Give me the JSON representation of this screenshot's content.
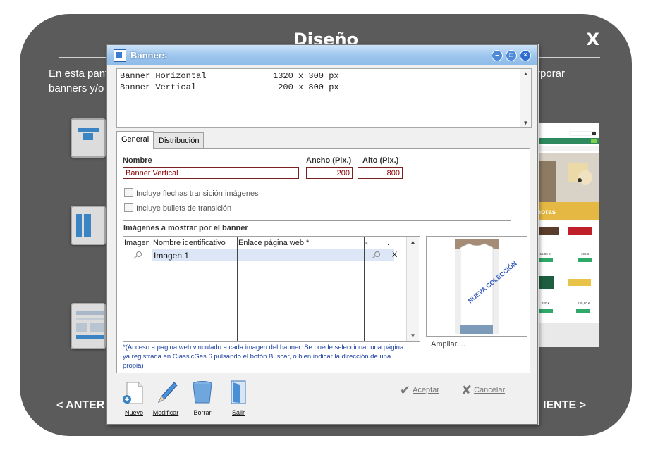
{
  "overlay": {
    "title": "Diseño",
    "close": "X",
    "desc_part1": "En esta pant",
    "desc_part1b": "banners y/o",
    "desc_part2": "rporar",
    "prev_label": "< ANTER",
    "next_label": "IENTE >"
  },
  "preview": {
    "banner_text": "horas",
    "prices": [
      "465,95 €",
      "195 €",
      "320 €",
      "145,90 €"
    ]
  },
  "dialog": {
    "title": "Banners",
    "list": [
      {
        "name": "Banner Horizontal",
        "size": "1320 x 300 px"
      },
      {
        "name": "Banner Vertical",
        "size": " 200 x 800 px"
      }
    ],
    "tabs": {
      "general": "General",
      "distribution": "Distribución"
    },
    "form": {
      "name_label": "Nombre",
      "width_label": "Ancho (Pix.)",
      "height_label": "Alto (Pix.)",
      "name_value": "Banner Vertical",
      "width_value": "200",
      "height_value": "800",
      "check1": "Incluye flechas transición imágenes",
      "check2": "Incluye bullets de transición"
    },
    "images": {
      "section_title": "Imágenes a mostrar por el banner",
      "headers": [
        "Imagen",
        "Nombre identificativo",
        "Enlace página web *",
        "-",
        "."
      ],
      "rows": [
        {
          "name": "Imagen 1",
          "delete": "X"
        }
      ],
      "note": "*(Acceso a pagina web vinculado a cada imagen del banner. Se puede seleccionar una página ya registrada en ClassicGes 6 pulsando el botón Buscar, o bien indicar la dirección de una propia)",
      "thumb_text": "NUEVA COLECCIÓN",
      "zoom": "Ampliar...."
    },
    "toolbar": {
      "new": "Nuevo",
      "edit": "Modificar",
      "delete": "Borrar",
      "exit": "Salir",
      "accept": "Aceptar",
      "cancel": "Cancelar"
    }
  }
}
